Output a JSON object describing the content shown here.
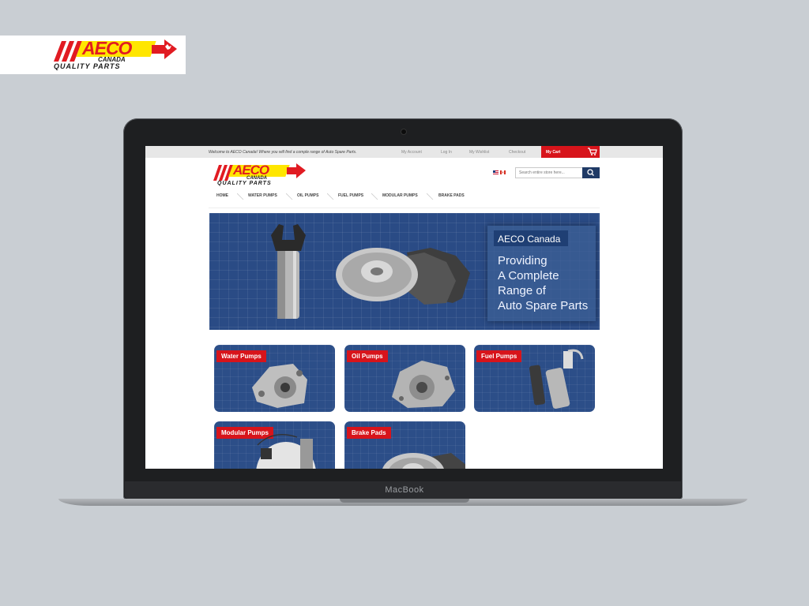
{
  "brand": {
    "word": "AECO",
    "sub": "CANADA",
    "tagline": "QUALITY PARTS",
    "colors": {
      "red": "#e11b22",
      "yellow": "#ffe600",
      "navy": "#1f3a66",
      "blue": "#2a4b85"
    }
  },
  "device": {
    "label": "MacBook"
  },
  "site": {
    "topbar": {
      "welcome": "Welcome to AECO Canada! Where you will find a comple range of Auto Spare Parts.",
      "links": [
        "My Account",
        "Log In",
        "My Wishlist",
        "Checkout"
      ],
      "cart": "My Cart"
    },
    "search": {
      "placeholder": "Search entire store here..."
    },
    "nav": [
      "HOME",
      "WATER PUMPS",
      "OIL PUMPS",
      "FUEL PUMPS",
      "MODULAR PUMPS",
      "BRAKE PADS"
    ],
    "hero": {
      "title": "AECO Canada",
      "lines": [
        "Providing",
        "A Complete",
        "Range of",
        "Auto Spare Parts"
      ]
    },
    "categories": [
      "Water Pumps",
      "Oil Pumps",
      "Fuel Pumps",
      "Modular Pumps",
      "Brake Pads"
    ]
  }
}
